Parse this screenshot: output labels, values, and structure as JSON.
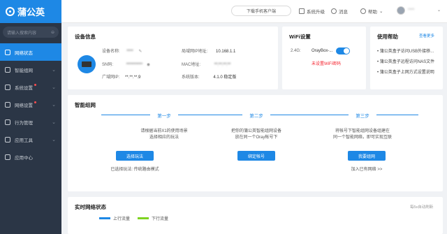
{
  "brand": {
    "name": "蒲公英",
    "color": "#1e88e5"
  },
  "sidebar": {
    "search_placeholder": "请输入搜索内容",
    "items": [
      {
        "label": "网络状态",
        "active": true,
        "icon": "monitor-icon"
      },
      {
        "label": "智能组网",
        "icon": "network-icon"
      },
      {
        "label": "系统设置",
        "icon": "gear-icon",
        "badge": true
      },
      {
        "label": "网络设置",
        "icon": "globe-icon",
        "badge": true
      },
      {
        "label": "行为管理",
        "icon": "shield-icon"
      },
      {
        "label": "应用工具",
        "icon": "tools-icon"
      },
      {
        "label": "应用中心",
        "icon": "apps-icon"
      }
    ]
  },
  "topbar": {
    "download_label": "下载手机客户端",
    "upgrade_label": "系统升级",
    "messages_label": "消息",
    "help_label": "帮助",
    "user_name": "****"
  },
  "device_info": {
    "title": "设备信息",
    "name_label": "设备名称:",
    "name_value": "****",
    "sn_label": "SN码:",
    "sn_value": "**********",
    "wan_ip_label": "广域网IP:",
    "wan_ip_value": "**.**.**.9",
    "lan_ip_label": "局域网IP地址:",
    "lan_ip_value": "10.168.1.1",
    "mac_label": "MAC地址:",
    "mac_value": "**:**:**:**",
    "version_label": "系统版本:",
    "version_value": "4.1.0 稳定版"
  },
  "wifi": {
    "title": "WiFi设置",
    "band": "2.4G:",
    "ssid": "OrayBox-...",
    "enabled": true,
    "warning": "未设置WiFi密码"
  },
  "help": {
    "title": "使用帮助",
    "more_label": "查看更多",
    "items": [
      "蒲公英盒子访问USB外接移...",
      "蒲公英盒子远程访问NAS文件",
      "蒲公英盒子上网方式设置说明"
    ]
  },
  "smart_network": {
    "title": "智能组网",
    "steps": [
      {
        "label": "第一步",
        "desc_line1": "请根据当前X1的使用场景",
        "desc_line2": "选择相应的玩法",
        "button": "选择玩法",
        "note": "已选择玩法: 传统路由模式"
      },
      {
        "label": "第二步",
        "desc_line1": "把你的蒲公英智能组网设备",
        "desc_line2": "放在同一个Oray帐号下",
        "button": "绑定帐号",
        "note": ""
      },
      {
        "label": "第三步",
        "desc_line1": "将帐号下智能组网设备组建在",
        "desc_line2": "同一个智能网络，即可实现互联",
        "button": "我要组网",
        "note": "加入已有网络 >>"
      }
    ]
  },
  "realtime": {
    "title": "实时网络状态",
    "refresh_note": "每5s自动刷新",
    "legend": [
      {
        "label": "上行流量",
        "color": "#1e88e5"
      },
      {
        "label": "下行流量",
        "color": "#7ed321"
      }
    ]
  }
}
